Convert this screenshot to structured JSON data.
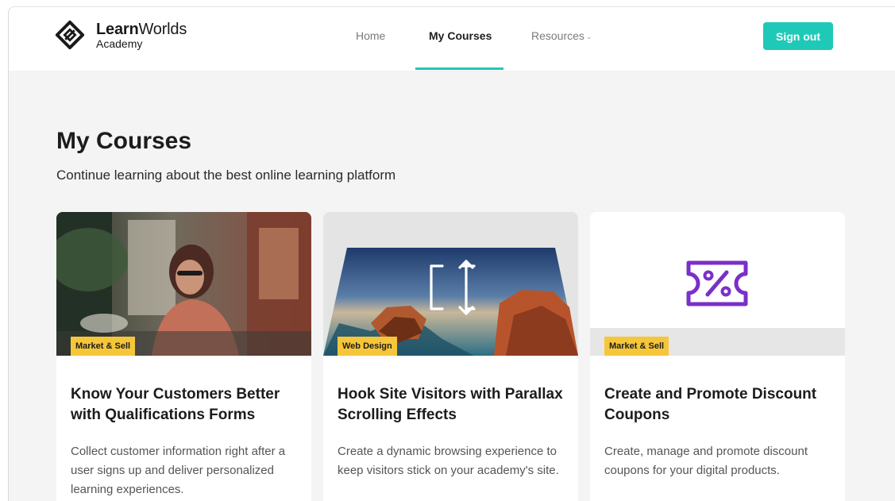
{
  "brand": {
    "name_bold": "Learn",
    "name_rest": "Worlds",
    "sub": "Academy"
  },
  "nav": {
    "items": [
      {
        "label": "Home",
        "active": false
      },
      {
        "label": "My Courses",
        "active": true
      },
      {
        "label": "Resources",
        "active": false,
        "has_dropdown": true
      }
    ],
    "dropdown_icon": "chevron-down-icon"
  },
  "header": {
    "signout_label": "Sign out"
  },
  "page": {
    "title": "My Courses",
    "subtitle": "Continue learning about the best online learning platform"
  },
  "colors": {
    "accent": "#1fc9b8",
    "badge": "#f6c63a",
    "coupon_purple": "#7b2fc9",
    "background": "#f4f4f4"
  },
  "courses": [
    {
      "badge": "Market & Sell",
      "title": "Know Your Customers Better with Qualifications Forms",
      "description": "Collect customer information right after a user signs up and deliver personalized learning experiences.",
      "image": "woman-at-desk-photo"
    },
    {
      "badge": "Web Design",
      "title": "Hook Site Visitors with Parallax Scrolling Effects",
      "description": "Create a dynamic browsing experience to keep visitors stick on your academy's site.",
      "image": "parallax-landscape-with-scroll-icon"
    },
    {
      "badge": "Market & Sell",
      "title": "Create and Promote Discount Coupons",
      "description": "Create, manage and promote discount coupons for your digital products.",
      "image": "discount-coupon-icon"
    }
  ]
}
